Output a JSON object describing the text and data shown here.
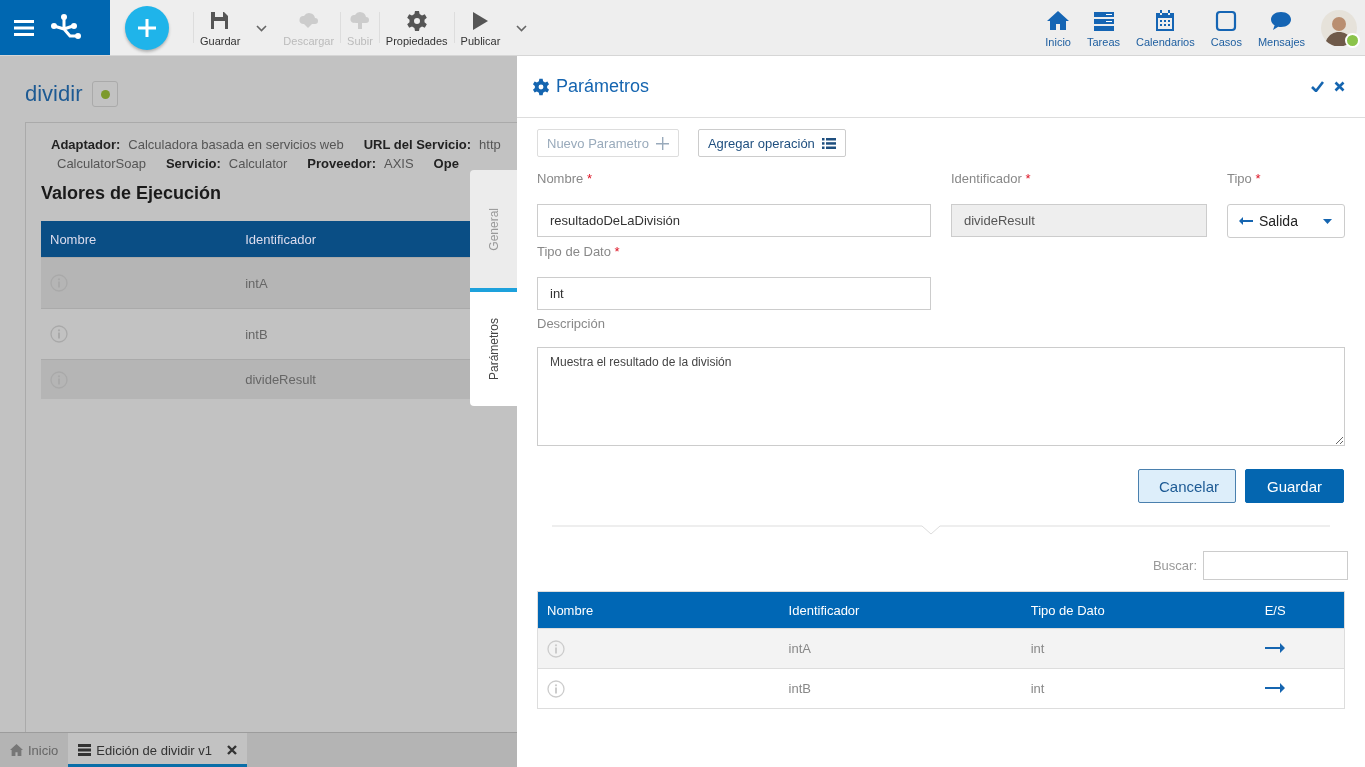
{
  "toolbar": [
    {
      "label": "Guardar",
      "kind": "save",
      "disabled": false,
      "has_menu": true
    },
    {
      "label": "Descargar",
      "kind": "download",
      "disabled": true,
      "has_menu": false
    },
    {
      "label": "Subir",
      "kind": "upload",
      "disabled": true,
      "has_menu": false
    },
    {
      "label": "Propiedades",
      "kind": "gear",
      "disabled": false,
      "has_menu": false
    },
    {
      "label": "Publicar",
      "kind": "play",
      "disabled": false,
      "has_menu": true
    }
  ],
  "nav": [
    {
      "label": "Inicio",
      "kind": "home"
    },
    {
      "label": "Tareas",
      "kind": "tasks"
    },
    {
      "label": "Calendarios",
      "kind": "calendar"
    },
    {
      "label": "Casos",
      "kind": "cases"
    },
    {
      "label": "Mensajes",
      "kind": "messages"
    }
  ],
  "user": {
    "online": true
  },
  "editor": {
    "title": "dividir",
    "meta_lines": [
      [
        {
          "label": "Adaptador:",
          "value": "Calculadora basada en servicios web"
        },
        {
          "label": "URL del Servicio:",
          "value": "http"
        }
      ],
      [
        {
          "value": "CalculatorSoap"
        },
        {
          "label": "Servicio:",
          "value": "Calculator"
        },
        {
          "label": "Proveedor:",
          "value": "AXIS"
        },
        {
          "label": "Ope"
        }
      ]
    ],
    "section_title": "Valores de Ejecución",
    "table": {
      "columns": [
        "Nombre",
        "Identificador"
      ],
      "rows": [
        {
          "identifier": "intA"
        },
        {
          "identifier": "intB"
        },
        {
          "identifier": "divideResult"
        }
      ]
    }
  },
  "side_tabs": [
    {
      "label": "General",
      "selected": false
    },
    {
      "label": "Parámetros",
      "selected": true
    }
  ],
  "bottom_tabs": [
    {
      "label": "Inicio",
      "kind": "home",
      "selected": false,
      "closable": false
    },
    {
      "label": "Edición de dividir v1",
      "kind": "editor",
      "selected": true,
      "closable": true
    }
  ],
  "panel": {
    "title": "Parámetros",
    "buttons": [
      {
        "label": "Nuevo Parametro",
        "kind": "add",
        "disabled": true
      },
      {
        "label": "Agregar operación",
        "kind": "list",
        "disabled": false
      }
    ],
    "fields": [
      {
        "label": "Nombre",
        "required_mark": "*",
        "kind": "text",
        "value": "resultadoDeLaDivisión"
      },
      {
        "label": "Identificador",
        "required_mark": "*",
        "kind": "readonly",
        "value": "divideResult"
      },
      {
        "label": "Tipo",
        "required_mark": "*",
        "kind": "select",
        "value": "Salida"
      },
      {
        "label": "Tipo de Dato",
        "required_mark": "*",
        "kind": "text",
        "value": "int"
      },
      {
        "label": "Descripción",
        "kind": "textarea",
        "value": "Muestra el resultado de la división"
      }
    ],
    "actions": [
      {
        "label": "Cancelar",
        "kind": "secondary"
      },
      {
        "label": "Guardar",
        "kind": "primary"
      }
    ],
    "search": {
      "label": "Buscar:"
    },
    "table": {
      "columns": [
        "Nombre",
        "Identificador",
        "Tipo de Dato",
        "E/S"
      ],
      "rows": [
        {
          "identifier": "intA",
          "data_type": "int",
          "kind": "input"
        },
        {
          "identifier": "intB",
          "data_type": "int",
          "kind": "input"
        }
      ]
    }
  }
}
